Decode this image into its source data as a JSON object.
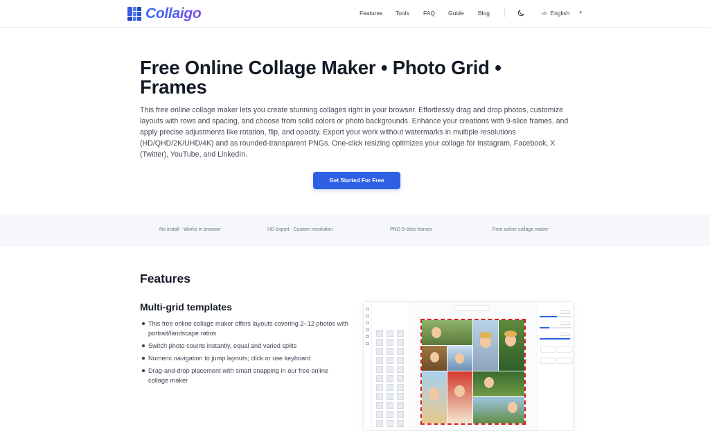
{
  "header": {
    "logo_text": "Collaigo",
    "nav": [
      {
        "label": "Features"
      },
      {
        "label": "Tools"
      },
      {
        "label": "FAQ"
      },
      {
        "label": "Guide"
      },
      {
        "label": "Blog"
      }
    ],
    "theme_icon": "moon-icon",
    "language": {
      "flag": "us",
      "label": "English"
    }
  },
  "hero": {
    "title": "Free Online Collage Maker • Photo Grid • Frames",
    "description": "This free online collage maker lets you create stunning collages right in your browser. Effortlessly drag and drop photos, customize layouts with rows and spacing, and choose from solid colors or photo backgrounds. Enhance your creations with 9-slice frames, and apply precise adjustments like rotation, flip, and opacity. Export your work without watermarks in multiple resolutions (HD/QHD/2K/UHD/4K) and as rounded-transparent PNGs. One-click resizing optimizes your collage for Instagram, Facebook, X (Twitter), YouTube, and LinkedIn.",
    "cta_label": "Get Started For Free"
  },
  "highlights": [
    "No install · Works in browser",
    "HD export · Custom resolution",
    "PNG 9-slice frames",
    "Free online collage maker"
  ],
  "features": {
    "title": "Features",
    "sections": [
      {
        "title": "Multi-grid templates",
        "bullets": [
          "This free online collage maker offers layouts covering 2–12 photos with portrait/landscape ratios",
          "Switch photo counts instantly, equal and varied splits",
          "Numeric navigation to jump layouts; click or use keyboard",
          "Drag-and-drop placement with smart snapping in our free online collage maker"
        ]
      }
    ]
  },
  "colors": {
    "accent": "#2f5fe3",
    "brand_gradient_start": "#2d6cf0",
    "brand_gradient_end": "#7b4ee8",
    "collage_border": "#d92020",
    "strip_bg": "#f5f7fa"
  }
}
